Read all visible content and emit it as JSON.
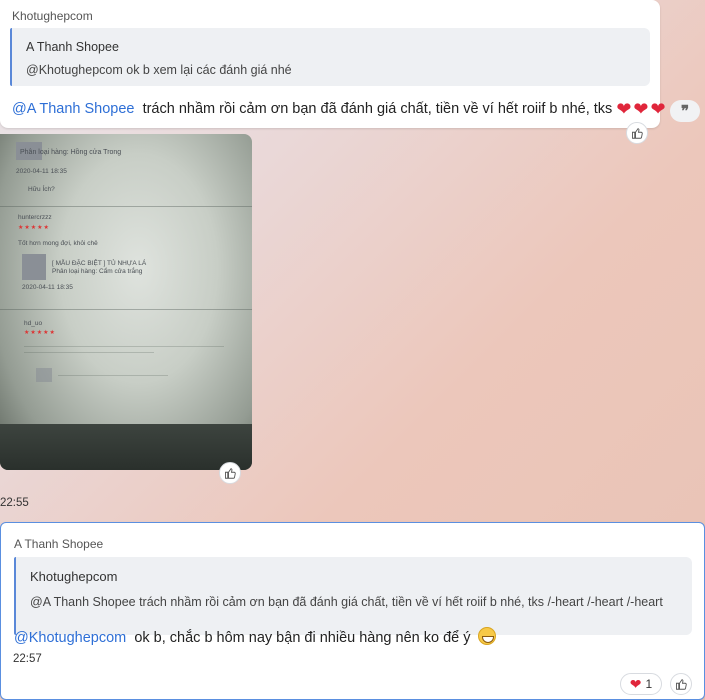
{
  "messages": [
    {
      "sender": "Khotughepcom",
      "quote": {
        "name": "A Thanh Shopee",
        "text": "@Khotughepcom ok b xem lại các đánh giá nhé"
      },
      "mention": "@A Thanh Shopee",
      "text": "trách nhầm rồi cảm ơn bạn đã đánh giá chất, tiền về ví hết roiif b nhé, tks",
      "hearts": "❤❤❤"
    },
    {
      "sender": "A Thanh Shopee",
      "quote": {
        "name": "Khotughepcom",
        "text": "@A Thanh Shopee trách nhầm rồi cảm ơn bạn đã đánh giá chất, tiền về ví hết roiif b nhé, tks /-heart /-heart /-heart"
      },
      "mention": "@Khotughepcom",
      "text": "ok b, chắc b hôm nay bận đi nhiều hàng nên ko để ý",
      "time": "22:57",
      "reaction_count": "1"
    }
  ],
  "photo": {
    "time": "22:55",
    "screen_texts": {
      "variant1": "Phân loại hàng: Hồng cửa Trong",
      "date1": "2020-04-11 18:35",
      "helpful": "Hữu Ích?",
      "user": "huntercrzzz",
      "review": "Tốt hơn mong đợi, khỏi chê",
      "product": "[ MẪU ĐẶC BIỆT ] TỦ NHỰA LÁ",
      "variant2": "Phân loại hàng: Cẩm cửa trắng",
      "date2": "2020-04-11 18:35",
      "user2": "hd_uo"
    }
  },
  "colors": {
    "mention": "#2e6fd6",
    "heart": "#e0263b",
    "quote_bar": "#5a88d8",
    "selected_border": "#5a8fe0"
  },
  "icons": {
    "like": "thumbs-up-icon",
    "quote": "quote-icon",
    "reaction": "heart-icon",
    "emoji": "grin-emoji-icon"
  }
}
